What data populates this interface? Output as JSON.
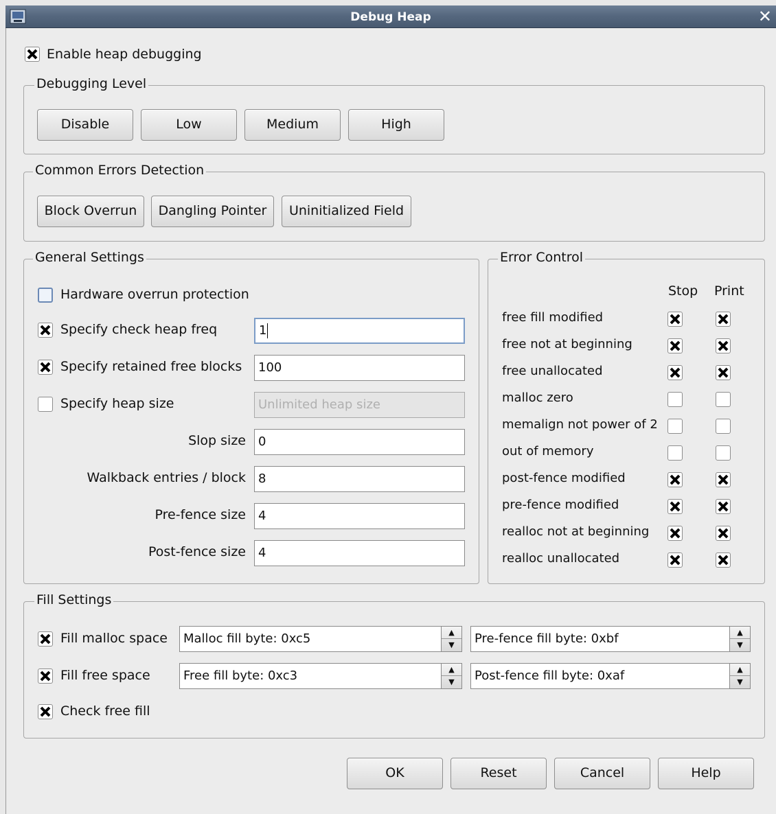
{
  "window": {
    "title": "Debug Heap",
    "icon": "app-icon",
    "close_icon": "close-icon"
  },
  "enable": {
    "label": "Enable heap debugging",
    "checked": true
  },
  "debugging_level": {
    "title": "Debugging Level",
    "buttons": [
      "Disable",
      "Low",
      "Medium",
      "High"
    ]
  },
  "common_errors": {
    "title": "Common Errors Detection",
    "buttons": [
      "Block Overrun",
      "Dangling Pointer",
      "Uninitialized Field"
    ]
  },
  "general": {
    "title": "General Settings",
    "hardware_overrun": {
      "label": "Hardware overrun protection",
      "checked": false
    },
    "check_heap_freq": {
      "label": "Specify check heap freq",
      "checked": true,
      "value": "1"
    },
    "retained_free": {
      "label": "Specify retained free blocks",
      "checked": true,
      "value": "100"
    },
    "heap_size": {
      "label": "Specify heap size",
      "checked": false,
      "placeholder": "Unlimited heap size"
    },
    "slop_size": {
      "label": "Slop size",
      "value": "0"
    },
    "walkback": {
      "label": "Walkback entries / block",
      "value": "8"
    },
    "pre_fence": {
      "label": "Pre-fence size",
      "value": "4"
    },
    "post_fence": {
      "label": "Post-fence size",
      "value": "4"
    }
  },
  "error_control": {
    "title": "Error Control",
    "col_stop": "Stop",
    "col_print": "Print",
    "rows": [
      {
        "label": "free fill modified",
        "stop": true,
        "print": true
      },
      {
        "label": "free not at beginning",
        "stop": true,
        "print": true
      },
      {
        "label": "free unallocated",
        "stop": true,
        "print": true
      },
      {
        "label": "malloc zero",
        "stop": false,
        "print": false
      },
      {
        "label": "memalign not power of 2",
        "stop": false,
        "print": false
      },
      {
        "label": "out of memory",
        "stop": false,
        "print": false
      },
      {
        "label": "post-fence modified",
        "stop": true,
        "print": true
      },
      {
        "label": "pre-fence modified",
        "stop": true,
        "print": true
      },
      {
        "label": "realloc not at beginning",
        "stop": true,
        "print": true
      },
      {
        "label": "realloc unallocated",
        "stop": true,
        "print": true
      }
    ]
  },
  "fill": {
    "title": "Fill Settings",
    "fill_malloc": {
      "label": "Fill malloc space",
      "checked": true
    },
    "fill_free": {
      "label": "Fill free space",
      "checked": true
    },
    "check_free": {
      "label": "Check free fill",
      "checked": true
    },
    "malloc_byte": "Malloc fill byte: 0xc5",
    "pre_fence_byte": "Pre-fence fill byte: 0xbf",
    "free_byte": "Free fill byte: 0xc3",
    "post_fence_byte": "Post-fence fill byte: 0xaf"
  },
  "footer": {
    "ok": "OK",
    "reset": "Reset",
    "cancel": "Cancel",
    "help": "Help"
  }
}
